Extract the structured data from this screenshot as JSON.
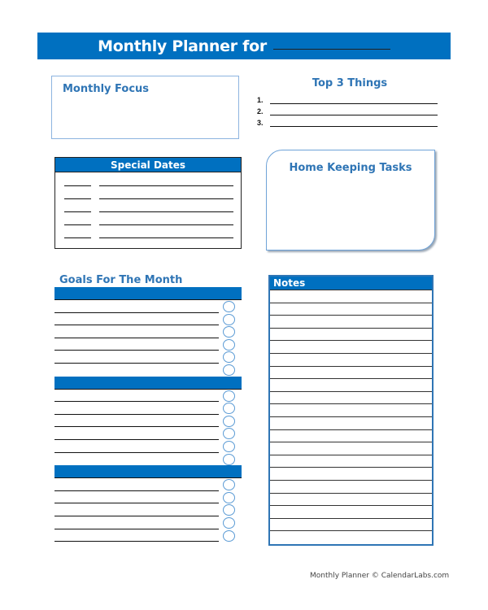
{
  "title": {
    "text": "Monthly Planner for",
    "accent_color": "#0070c0"
  },
  "monthly_focus": {
    "heading": "Monthly Focus"
  },
  "top3": {
    "heading": "Top 3 Things",
    "items": [
      {
        "num": "1."
      },
      {
        "num": "2."
      },
      {
        "num": "3."
      }
    ]
  },
  "special_dates": {
    "heading": "Special Dates",
    "row_count": 5
  },
  "home_keeping": {
    "heading": "Home Keeping Tasks"
  },
  "goals": {
    "heading": "Goals For The Month",
    "groups": [
      {
        "rows": 6
      },
      {
        "rows": 6
      },
      {
        "rows": 5
      }
    ]
  },
  "notes": {
    "heading": "Notes",
    "row_count": 20
  },
  "footer": {
    "text": "Monthly Planner © CalendarLabs.com"
  }
}
